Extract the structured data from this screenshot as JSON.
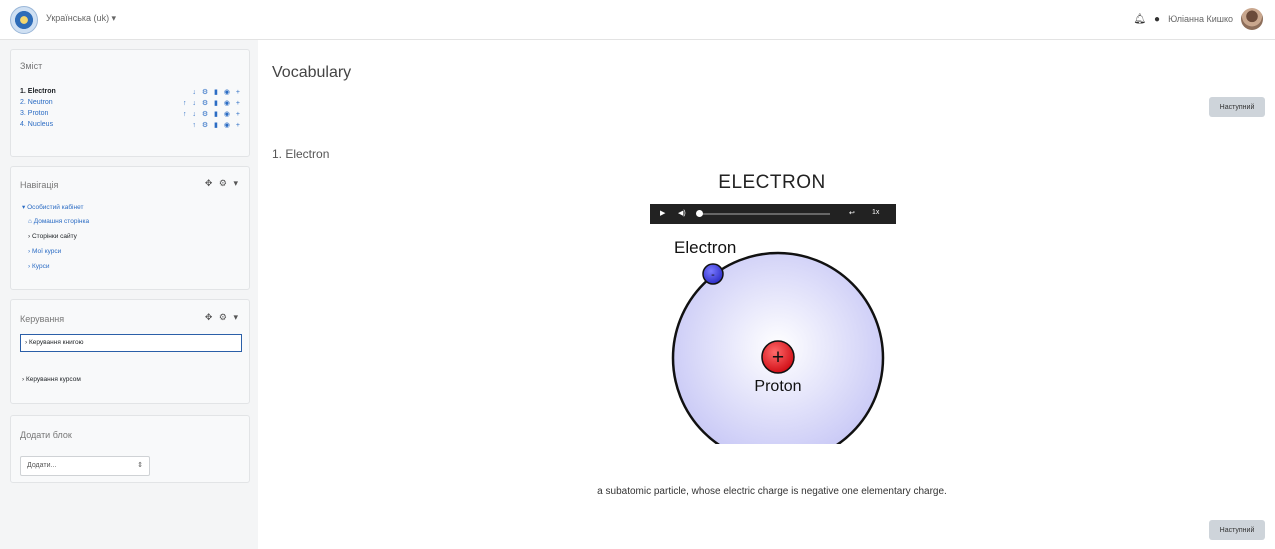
{
  "header": {
    "lang": "Українська (uk) ▾",
    "user": "Юліанна Кишко"
  },
  "sidebar": {
    "contents": {
      "title": "Зміст",
      "items": [
        {
          "label": "1. Electron",
          "icons": "↓ ⚙ ▮ ◉ +"
        },
        {
          "label": "2. Neutron",
          "icons": "↑ ↓ ⚙ ▮ ◉ +"
        },
        {
          "label": "3. Proton",
          "icons": "↑ ↓ ⚙ ▮ ◉ +"
        },
        {
          "label": "4. Nucleus",
          "icons": "↑ ⚙ ▮ ◉ +"
        }
      ]
    },
    "navigation": {
      "title": "Навігація",
      "items": [
        "Особистий кабінет",
        "Домашня сторінка",
        "Сторінки сайту",
        "Мої курси",
        "Курси"
      ]
    },
    "management": {
      "title": "Керування",
      "items": [
        "Керування книгою",
        "Керування курсом"
      ]
    },
    "addblock": {
      "title": "Додати блок",
      "select": "Додати..."
    }
  },
  "main": {
    "title": "Vocabulary",
    "next_label": "Наступний",
    "section": "1. Electron",
    "card_title": "ELECTRON",
    "player": {
      "rate": "1x"
    },
    "diagram": {
      "electron_label": "Electron",
      "proton_label": "Proton",
      "electron_sign": "-",
      "proton_sign": "+"
    },
    "description": "a subatomic particle,  whose electric charge is negative one elementary charge."
  },
  "colors": {
    "link": "#2b6cc4",
    "button": "#ced4da",
    "atom_fill": "#d9d9fb",
    "proton": "#e8262c",
    "electron": "#4a4ae0"
  }
}
